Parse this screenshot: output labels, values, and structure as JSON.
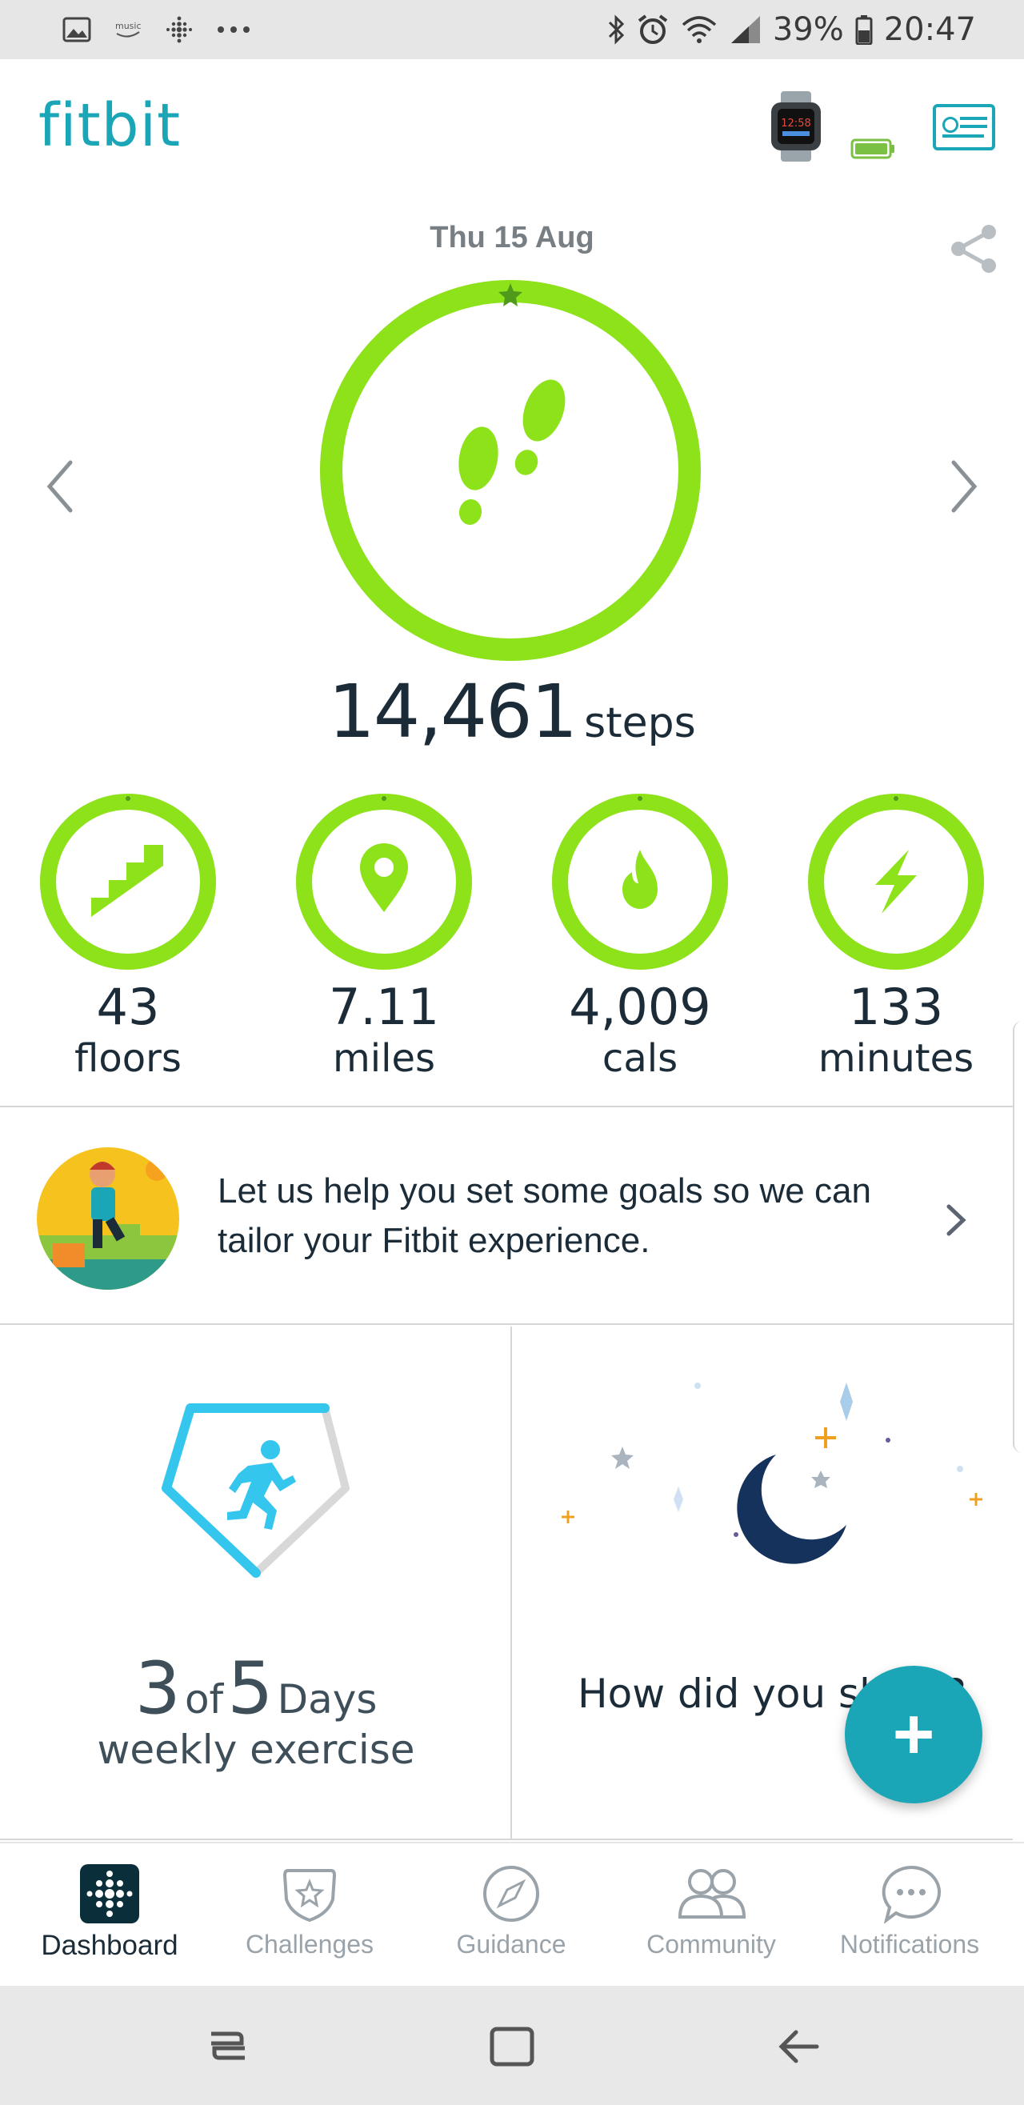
{
  "status_bar": {
    "battery_pct": "39%",
    "time": "20:47",
    "notification_icons": [
      "gallery-icon",
      "amazon-music-icon",
      "fitbit-icon",
      "more-icon"
    ],
    "system_icons": [
      "bluetooth-icon",
      "alarm-icon",
      "wifi-icon",
      "signal-icon",
      "battery-icon"
    ]
  },
  "header": {
    "logo": "fitbit",
    "device_battery_color": "#7ac143",
    "accent_color": "#1aa6b7"
  },
  "summary": {
    "date": "Thu 15 Aug",
    "steps_value": "14,461",
    "steps_unit": "steps",
    "steps_goal_progress": 1.0,
    "ring_color": "#8ee21a"
  },
  "stats": [
    {
      "value": "43",
      "unit": "floors",
      "icon": "stairs-icon",
      "progress": 1.0
    },
    {
      "value": "7.11",
      "unit": "miles",
      "icon": "location-pin-icon",
      "progress": 1.0
    },
    {
      "value": "4,009",
      "unit": "cals",
      "icon": "flame-icon",
      "progress": 1.0
    },
    {
      "value": "133",
      "unit": "minutes",
      "icon": "lightning-icon",
      "progress": 1.0
    }
  ],
  "goal_banner": {
    "text": "Let us help you set some goals so we can tailor your Fitbit experience."
  },
  "exercise_tile": {
    "done": "3",
    "of": "of",
    "total": "5",
    "days": "Days",
    "label": "weekly exercise",
    "progress": 0.6
  },
  "sleep_tile": {
    "prompt": "How did you sleep?"
  },
  "fab": {
    "label": "+"
  },
  "bottom_nav": [
    {
      "label": "Dashboard",
      "icon": "dashboard-icon",
      "active": true
    },
    {
      "label": "Challenges",
      "icon": "challenges-icon",
      "active": false
    },
    {
      "label": "Guidance",
      "icon": "compass-icon",
      "active": false
    },
    {
      "label": "Community",
      "icon": "community-icon",
      "active": false
    },
    {
      "label": "Notifications",
      "icon": "notifications-icon",
      "active": false
    }
  ]
}
